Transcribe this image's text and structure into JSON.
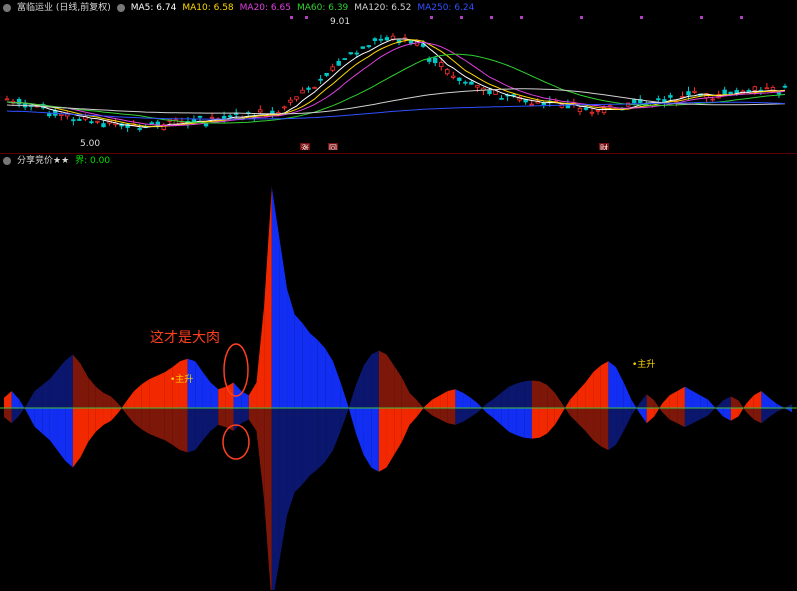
{
  "main_header": {
    "title": "富临运业 (日线,前复权)",
    "ma": [
      {
        "label": "MA5: 6.74",
        "color": "#ffffff"
      },
      {
        "label": "MA10: 6.58",
        "color": "#ffd800"
      },
      {
        "label": "MA20: 6.65",
        "color": "#e040e0"
      },
      {
        "label": "MA60: 6.39",
        "color": "#30d030"
      },
      {
        "label": "MA120: 6.52",
        "color": "#d0d0d0"
      },
      {
        "label": "MA250: 6.24",
        "color": "#3050ff"
      }
    ]
  },
  "sub_header": {
    "title": "分享竞价★★",
    "value": "界: 0.00",
    "value_color": "#00e000"
  },
  "annotations": {
    "high_label": "9.01",
    "low_label": "5.00",
    "main_text": "这才是大肉",
    "signal_1": "主升",
    "signal_2": "主升",
    "event_1": "涨",
    "event_2": "回",
    "event_3": "财"
  },
  "colors": {
    "up_candle": "#ff3030",
    "down_candle": "#00c8c8",
    "indicator_red": "#ff2a00",
    "indicator_blue": "#1230ff",
    "indicator_darkred": "#8b1a0a",
    "indicator_darkblue": "#0c1a7a",
    "zero_line": "#40c040",
    "annotation": "#ff4020"
  },
  "chart_data": [
    {
      "type": "candlestick",
      "ma_periods": [
        5,
        10,
        20,
        60,
        120,
        250
      ],
      "price_high": 9.01,
      "price_low": 5.0,
      "bars": 120
    },
    {
      "type": "area",
      "series": [
        {
          "values": [
            0.12,
            0.2,
            0.1,
            -0.05,
            -0.22,
            -0.3,
            -0.38,
            -0.5,
            -0.62,
            -0.7,
            -0.58,
            -0.4,
            -0.28,
            -0.2,
            -0.15,
            -0.05,
            0.08,
            0.2,
            0.28,
            0.34,
            0.38,
            0.42,
            0.48,
            0.55,
            0.58,
            0.55,
            0.42,
            0.3,
            0.22,
            0.25,
            0.3,
            0.2,
            0.15,
            0.3,
            1.2,
            2.6,
            2.0,
            1.4,
            1.1,
            1.0,
            0.88,
            0.8,
            0.7,
            0.55,
            0.3,
            0.02,
            -0.3,
            -0.55,
            -0.7,
            -0.75,
            -0.7,
            -0.55,
            -0.4,
            -0.2,
            -0.1,
            0.02,
            0.1,
            0.15,
            0.2,
            0.22,
            0.18,
            0.12,
            0.05,
            -0.05,
            -0.12,
            -0.2,
            -0.28,
            -0.32,
            -0.35,
            -0.36,
            -0.35,
            -0.3,
            -0.2,
            -0.05,
            0.1,
            0.2,
            0.3,
            0.42,
            0.5,
            0.55,
            0.48,
            0.3,
            0.1,
            -0.05,
            -0.18,
            -0.1,
            0.05,
            0.15,
            0.2,
            0.25,
            0.2,
            0.15,
            0.1,
            0.0,
            -0.1,
            -0.15,
            -0.1,
            0.05,
            0.15,
            0.2,
            0.12,
            0.05,
            0.0,
            -0.05
          ]
        }
      ]
    }
  ]
}
